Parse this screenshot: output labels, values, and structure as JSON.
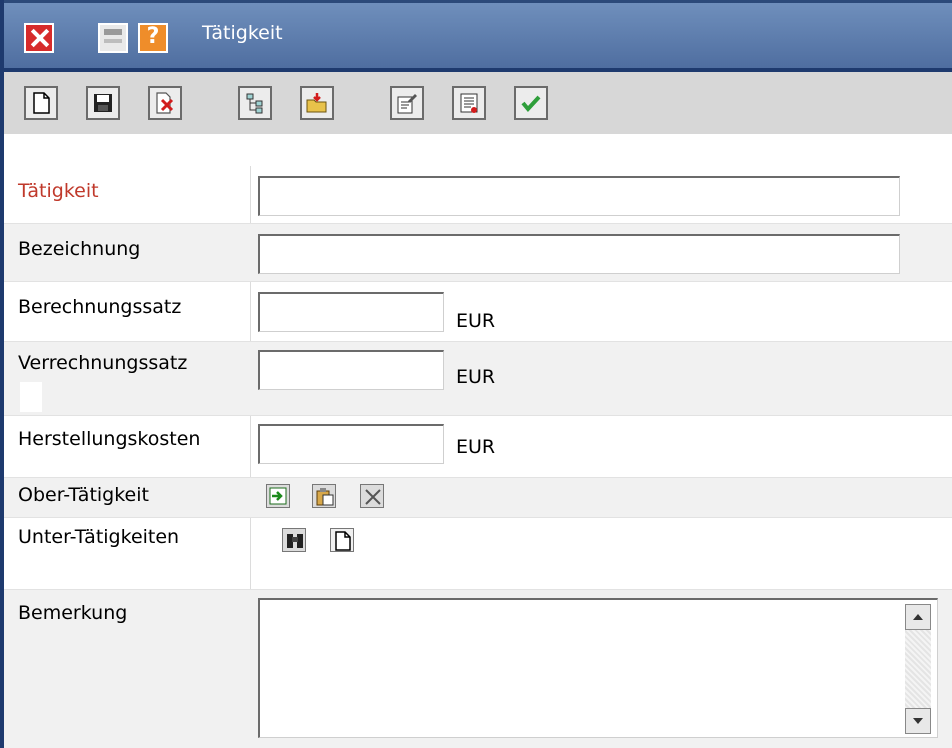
{
  "window": {
    "title": "Tätigkeit",
    "help_glyph": "?"
  },
  "toolbar": {
    "buttons": [
      {
        "name": "new-document-icon"
      },
      {
        "name": "save-icon"
      },
      {
        "name": "delete-icon"
      },
      {
        "name": "tree-structure-icon"
      },
      {
        "name": "open-folder-icon"
      },
      {
        "name": "edit-properties-icon"
      },
      {
        "name": "report-list-icon"
      },
      {
        "name": "confirm-check-icon"
      }
    ]
  },
  "form": {
    "taetigkeit": {
      "label": "Tätigkeit",
      "value": "",
      "label_color": "#c0392b"
    },
    "bezeichnung": {
      "label": "Bezeichnung",
      "value": ""
    },
    "berechnungssatz": {
      "label": "Berechnungssatz",
      "value": "",
      "unit": "EUR"
    },
    "verrechnungssatz": {
      "label": "Verrechnungssatz",
      "value": "",
      "unit": "EUR"
    },
    "herstellungskosten": {
      "label": "Herstellungskosten",
      "value": "",
      "unit": "EUR"
    },
    "ober_taetigkeit": {
      "label": "Ober-Tätigkeit"
    },
    "unter_taetigkeiten": {
      "label": "Unter-Tätigkeiten"
    },
    "bemerkung": {
      "label": "Bemerkung",
      "value": ""
    }
  },
  "colors": {
    "titlebar": "#5b79a8",
    "frame": "#1e3a6e",
    "required_label": "#c0392b",
    "check_green": "#2e9e3a"
  }
}
